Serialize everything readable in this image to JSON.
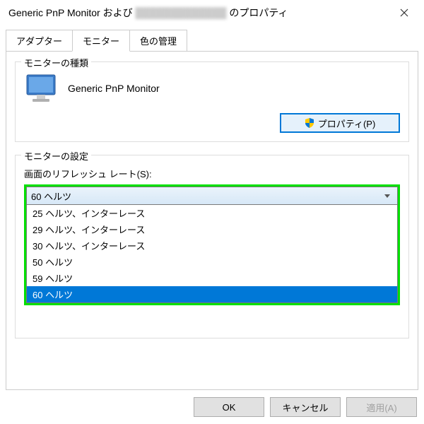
{
  "window": {
    "title_prefix": "Generic PnP Monitor および",
    "title_blurred": "█████████████",
    "title_suffix": "のプロパティ"
  },
  "tabs": {
    "adapter": "アダプター",
    "monitor": "モニター",
    "color": "色の管理"
  },
  "monitor_type": {
    "group_title": "モニターの種類",
    "name": "Generic PnP Monitor",
    "properties_button": "プロパティ(P)"
  },
  "monitor_settings": {
    "group_title": "モニターの設定",
    "refresh_label": "画面のリフレッシュ レート(S):",
    "selected": "60 ヘルツ",
    "options": [
      "25 ヘルツ、インターレース",
      "29 ヘルツ、インターレース",
      "30 ヘルツ、インターレース",
      "50 ヘルツ",
      "59 ヘルツ",
      "60 ヘルツ"
    ]
  },
  "buttons": {
    "ok": "OK",
    "cancel": "キャンセル",
    "apply": "適用(A)"
  }
}
